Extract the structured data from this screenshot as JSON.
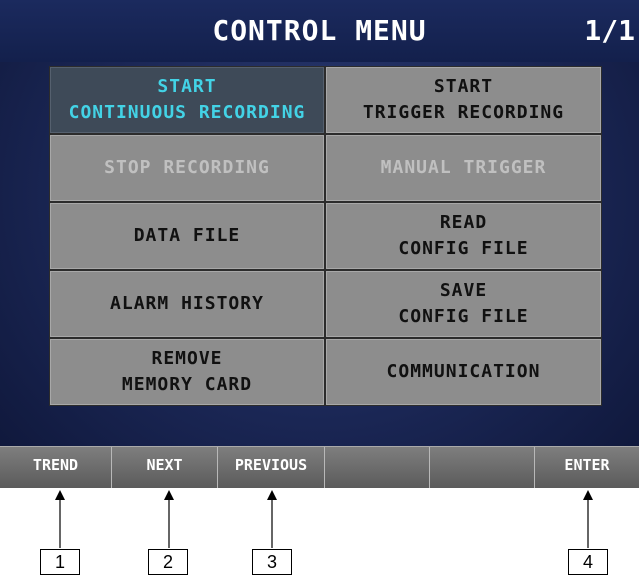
{
  "header": {
    "title": "CONTROL MENU",
    "page": "1/1"
  },
  "menu": [
    {
      "line1": "START",
      "line2": "CONTINUOUS RECORDING",
      "state": "selected"
    },
    {
      "line1": "START",
      "line2": "TRIGGER RECORDING",
      "state": "enabled"
    },
    {
      "line1": "STOP RECORDING",
      "line2": "",
      "state": "disabled"
    },
    {
      "line1": "MANUAL TRIGGER",
      "line2": "",
      "state": "disabled"
    },
    {
      "line1": "DATA FILE",
      "line2": "",
      "state": "enabled"
    },
    {
      "line1": "READ",
      "line2": "CONFIG FILE",
      "state": "enabled"
    },
    {
      "line1": "ALARM HISTORY",
      "line2": "",
      "state": "enabled"
    },
    {
      "line1": "SAVE",
      "line2": "CONFIG FILE",
      "state": "enabled"
    },
    {
      "line1": "REMOVE",
      "line2": "MEMORY CARD",
      "state": "enabled"
    },
    {
      "line1": "COMMUNICATION",
      "line2": "",
      "state": "enabled"
    }
  ],
  "function_keys": [
    "TREND",
    "NEXT",
    "PREVIOUS",
    "",
    "",
    "ENTER"
  ],
  "callouts": [
    "1",
    "2",
    "3",
    "4"
  ],
  "colors": {
    "screen_background": "#1a2654",
    "button_gray": "#8d8d8d",
    "selected_button": "#3e4a58",
    "selected_text": "#43d3e6",
    "disabled_text": "#c0c0c0"
  }
}
